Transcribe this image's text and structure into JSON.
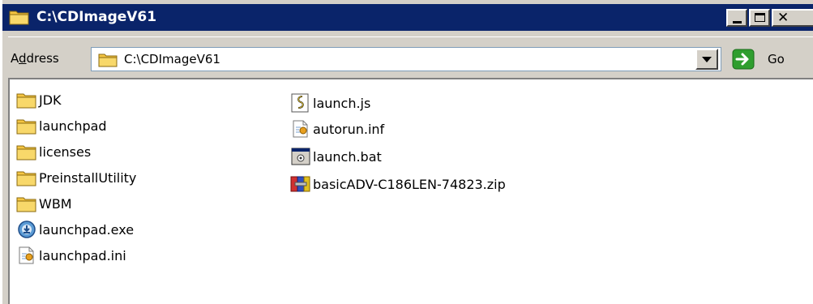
{
  "window": {
    "title": "C:\\CDImageV61",
    "accent": "#0a246a"
  },
  "address": {
    "label_prefix": "A",
    "label_access": "d",
    "label_rest": "dress",
    "value": "C:\\CDImageV61",
    "go_label": "Go"
  },
  "files": {
    "column1": [
      {
        "name": "JDK",
        "icon": "folder-icon"
      },
      {
        "name": "launchpad",
        "icon": "folder-icon"
      },
      {
        "name": "licenses",
        "icon": "folder-icon"
      },
      {
        "name": "PreinstallUtility",
        "icon": "folder-icon"
      },
      {
        "name": "WBM",
        "icon": "folder-icon"
      },
      {
        "name": "launchpad.exe",
        "icon": "installer-exe-icon"
      },
      {
        "name": "launchpad.ini",
        "icon": "settings-file-icon"
      }
    ],
    "column2": [
      {
        "name": "launch.js",
        "icon": "script-file-icon"
      },
      {
        "name": "autorun.inf",
        "icon": "settings-file-icon"
      },
      {
        "name": "launch.bat",
        "icon": "batch-file-icon"
      },
      {
        "name": "basicADV-C186LEN-74823.zip",
        "icon": "zip-archive-icon"
      }
    ]
  }
}
